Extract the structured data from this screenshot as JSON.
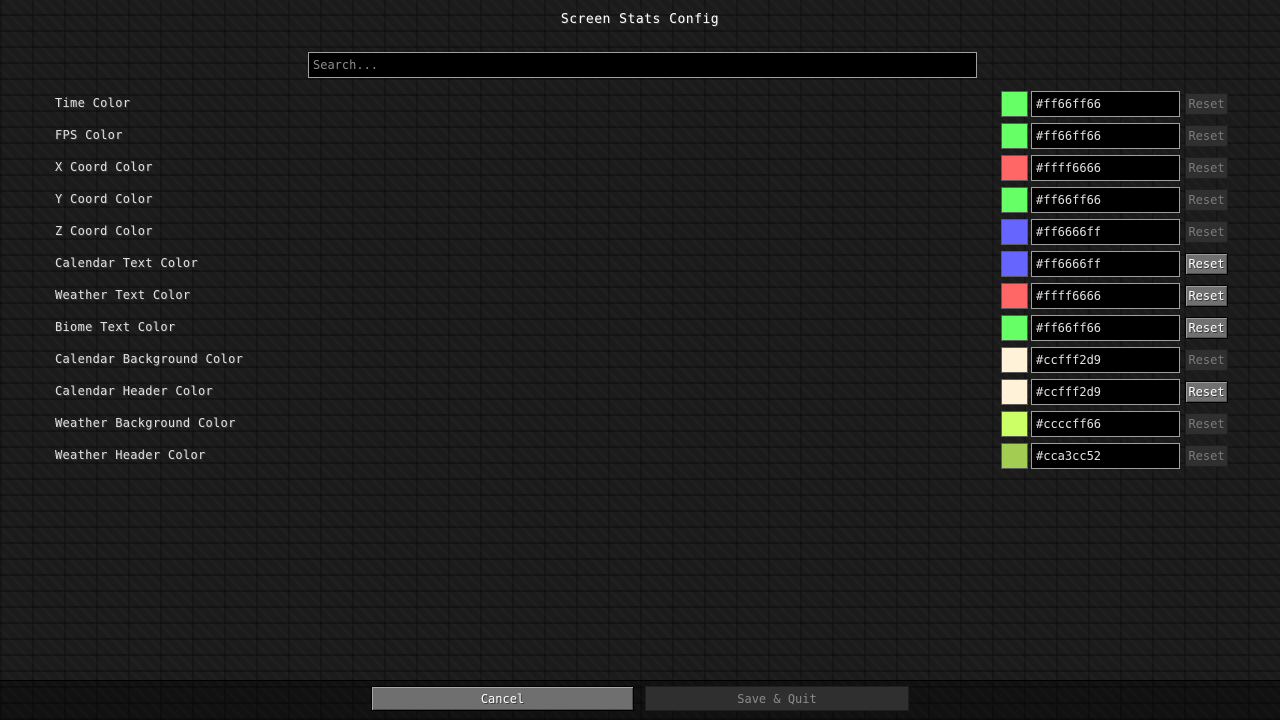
{
  "title": "Screen Stats Config",
  "search": {
    "placeholder": "Search...",
    "value": ""
  },
  "settings": [
    {
      "label": "Time Color",
      "value": "#ff66ff66",
      "swatch": "#66ff66",
      "reset_label": "Reset",
      "reset_enabled": false
    },
    {
      "label": "FPS Color",
      "value": "#ff66ff66",
      "swatch": "#66ff66",
      "reset_label": "Reset",
      "reset_enabled": false
    },
    {
      "label": "X Coord Color",
      "value": "#ffff6666",
      "swatch": "#ff6666",
      "reset_label": "Reset",
      "reset_enabled": false
    },
    {
      "label": "Y Coord Color",
      "value": "#ff66ff66",
      "swatch": "#66ff66",
      "reset_label": "Reset",
      "reset_enabled": false
    },
    {
      "label": "Z Coord Color",
      "value": "#ff6666ff",
      "swatch": "#6666ff",
      "reset_label": "Reset",
      "reset_enabled": false
    },
    {
      "label": "Calendar Text Color",
      "value": "#ff6666ff",
      "swatch": "#6666ff",
      "reset_label": "Reset",
      "reset_enabled": true
    },
    {
      "label": "Weather Text Color",
      "value": "#ffff6666",
      "swatch": "#ff6666",
      "reset_label": "Reset",
      "reset_enabled": true
    },
    {
      "label": "Biome Text Color",
      "value": "#ff66ff66",
      "swatch": "#66ff66",
      "reset_label": "Reset",
      "reset_enabled": true
    },
    {
      "label": "Calendar Background Color",
      "value": "#ccfff2d9",
      "swatch": "#fff2d9",
      "reset_label": "Reset",
      "reset_enabled": false
    },
    {
      "label": "Calendar Header Color",
      "value": "#ccfff2d9",
      "swatch": "#fff2d9",
      "reset_label": "Reset",
      "reset_enabled": true
    },
    {
      "label": "Weather Background Color",
      "value": "#ccccff66",
      "swatch": "#ccff66",
      "reset_label": "Reset",
      "reset_enabled": false
    },
    {
      "label": "Weather Header Color",
      "value": "#cca3cc52",
      "swatch": "#a3cc52",
      "reset_label": "Reset",
      "reset_enabled": false
    }
  ],
  "footer": {
    "cancel_label": "Cancel",
    "save_label": "Save & Quit",
    "save_enabled": false
  }
}
